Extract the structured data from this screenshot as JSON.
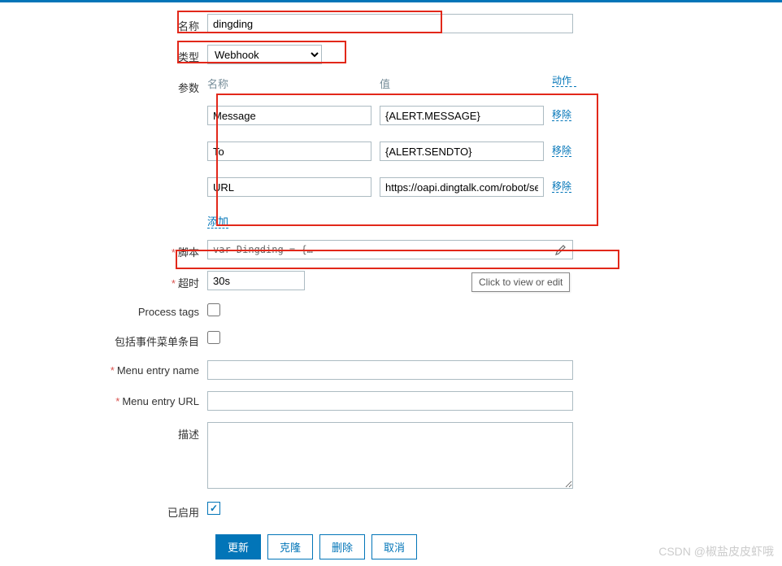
{
  "labels": {
    "name": "名称",
    "type": "类型",
    "params": "参数",
    "script": "脚本",
    "timeout": "超时",
    "process_tags": "Process tags",
    "include_menu": "包括事件菜单条目",
    "menu_name": "Menu entry name",
    "menu_url": "Menu entry URL",
    "description": "描述",
    "enabled": "已启用"
  },
  "values": {
    "name": "dingding",
    "type": "Webhook",
    "script": "var Dingding = {…",
    "timeout": "30s",
    "menu_name": "",
    "menu_url": "",
    "description": "",
    "enabled": true
  },
  "params": {
    "header": {
      "name": "名称",
      "value": "值",
      "action": "动作"
    },
    "rows": [
      {
        "name": "Message",
        "value": "{ALERT.MESSAGE}"
      },
      {
        "name": "To",
        "value": "{ALERT.SENDTO}"
      },
      {
        "name": "URL",
        "value": "https://oapi.dingtalk.com/robot/send?"
      }
    ],
    "remove": "移除",
    "add": "添加"
  },
  "tooltip": "Click to view or edit",
  "buttons": {
    "update": "更新",
    "clone": "克隆",
    "delete": "删除",
    "cancel": "取消"
  },
  "watermark": "CSDN @椒盐皮皮虾哦"
}
